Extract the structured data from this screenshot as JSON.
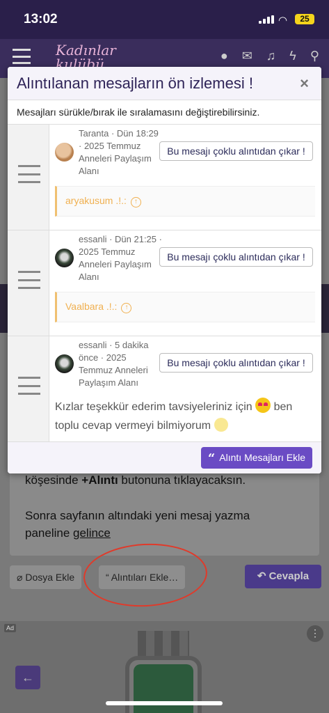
{
  "status": {
    "time": "13:02",
    "battery": "25"
  },
  "header": {
    "logo_line1": "Kadınlar",
    "logo_line2": "kulübü"
  },
  "background": {
    "post_line1_bold": "+Alıntı",
    "post_line1_pre": "köşesinde ",
    "post_line1_post": " butonuna tıklayacaksın.",
    "post_line2": "Sonra sayfanın altındaki yeni mesaj  yazma",
    "post_line3_pre": "paneline ",
    "post_line3_link": "gelince",
    "attach_label": "Dosya Ekle",
    "quotes_label": "Alıntıları Ekle…",
    "reply_label": "Cevapla",
    "ad_badge": "Ad"
  },
  "modal": {
    "title": "Alıntılanan mesajların ön izlemesi !",
    "close": "×",
    "description": "Mesajları sürükle/bırak ile sıralamasını değiştirebilirsiniz.",
    "remove_label": "Bu mesajı çoklu alıntıdan çıkar !",
    "add_label": "Alıntı Mesajları Ekle",
    "quotes": [
      {
        "meta": "Taranta · Dün 18:29 · 2025 Temmuz Anneleri Paylaşım Alanı",
        "inner_user": "aryakusum .!.:"
      },
      {
        "meta": "essanli · Dün 21:25 · 2025 Temmuz Anneleri Paylaşım Alanı",
        "inner_user": "Vaalbara .!.:"
      },
      {
        "meta": "essanli · 5 dakika önce · 2025 Temmuz Anneleri Paylaşım Alanı",
        "body_line1": "Kızlar teşekkür ederim tavsiyeleriniz için",
        "body_line1b": "ben",
        "body_line2": "toplu cevap vermeyi bilmiyorum"
      }
    ]
  }
}
